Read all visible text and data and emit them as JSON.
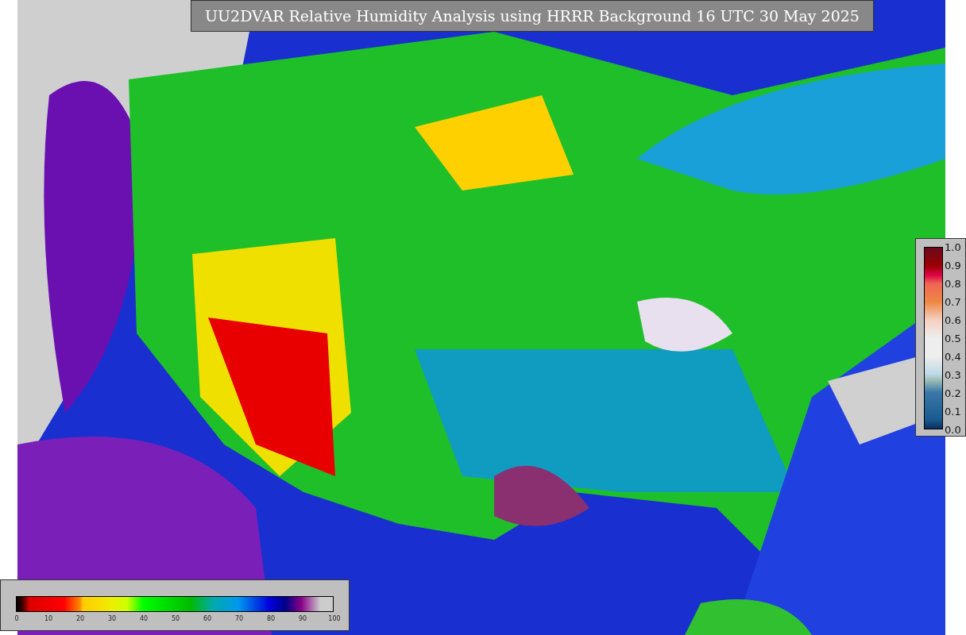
{
  "title": "UU2DVAR Relative Humidity Analysis using HRRR Background 16 UTC 30 May 2025",
  "humidity_legend": {
    "ticks": [
      "0",
      "10",
      "20",
      "30",
      "40",
      "50",
      "60",
      "70",
      "80",
      "90",
      "100"
    ]
  },
  "ratio_legend": {
    "ticks": [
      "1.0",
      "0.9",
      "0.8",
      "0.7",
      "0.6",
      "0.5",
      "0.4",
      "0.3",
      "0.2",
      "0.1",
      "0.0"
    ]
  }
}
